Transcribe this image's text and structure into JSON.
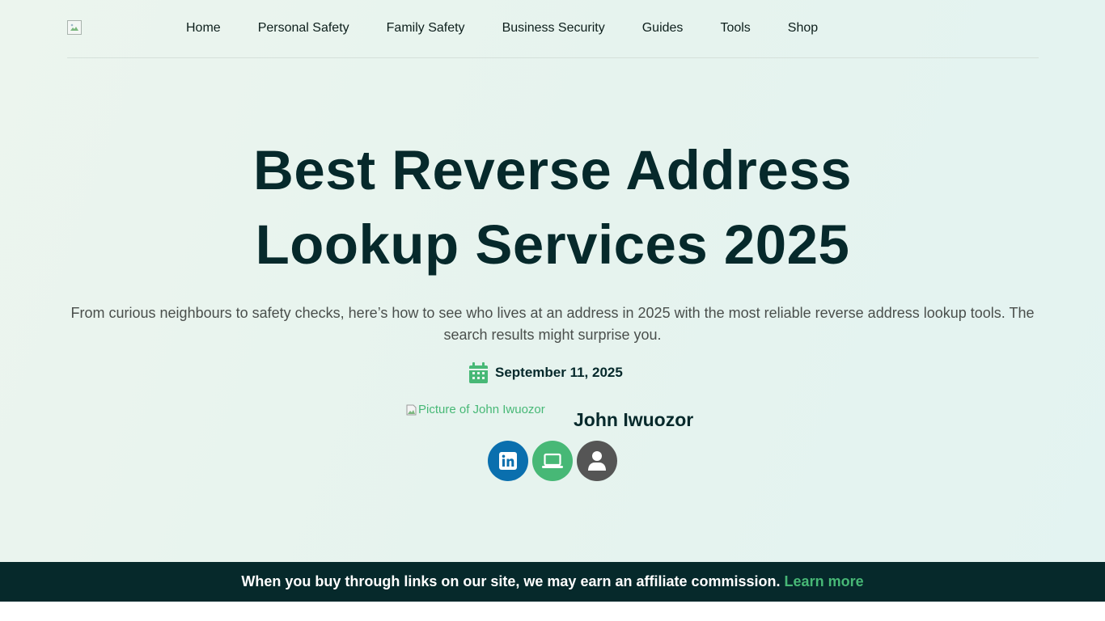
{
  "header": {
    "logo_alt": "",
    "nav": [
      {
        "label": "Home"
      },
      {
        "label": "Personal Safety"
      },
      {
        "label": "Family Safety"
      },
      {
        "label": "Business Security"
      },
      {
        "label": "Guides"
      },
      {
        "label": "Tools"
      },
      {
        "label": "Shop"
      }
    ]
  },
  "article": {
    "title_line1": "Best Reverse Address",
    "title_line2": "Lookup Services 2025",
    "subtitle": "From curious neighbours to safety checks, here’s how to see who lives at an address in 2025 with the most reliable reverse address lookup tools. The search results might surprise you.",
    "date": "September 11, 2025",
    "date_icon": "calendar-icon",
    "author": {
      "image_alt": "Picture of John Iwuozor",
      "name": "John Iwuozor",
      "socials": [
        {
          "icon": "linkedin-icon",
          "color": "#0a6fae"
        },
        {
          "icon": "laptop-icon",
          "color": "#47b876"
        },
        {
          "icon": "user-icon",
          "color": "#555555"
        }
      ]
    }
  },
  "affiliate_bar": {
    "text": "When you buy through links on our site, we may earn an affiliate commission.",
    "link_label": "Learn more"
  },
  "colors": {
    "accent": "#47b876",
    "dark": "#06292b",
    "linkedin": "#0a6fae"
  }
}
